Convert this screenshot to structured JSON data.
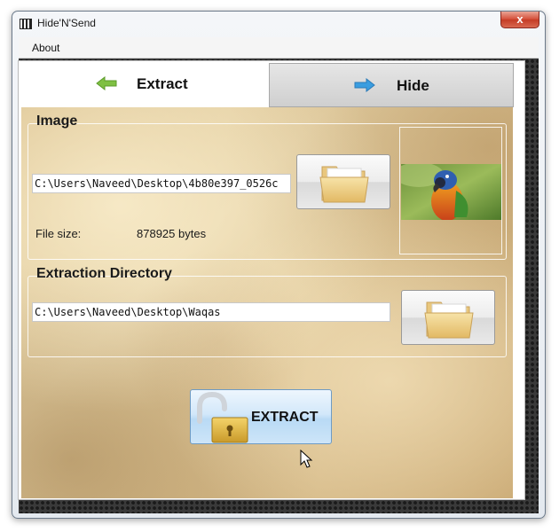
{
  "window": {
    "title": "Hide'N'Send",
    "close_glyph": "x"
  },
  "menu": {
    "items": [
      {
        "label": "About"
      }
    ]
  },
  "tabs": [
    {
      "label": "Extract",
      "icon": "arrow-left-icon",
      "active": true
    },
    {
      "label": "Hide",
      "icon": "arrow-right-icon",
      "active": false
    }
  ],
  "image_group": {
    "title": "Image",
    "path": "C:\\Users\\Naveed\\Desktop\\4b80e397_0526c",
    "file_size_label": "File size:",
    "file_size_value": "878925 bytes",
    "browse_icon": "folder-icon",
    "preview_icon": "parrot-photo"
  },
  "dir_group": {
    "title": "Extraction Directory",
    "path": "C:\\Users\\Naveed\\Desktop\\Waqas",
    "browse_icon": "folder-icon"
  },
  "actions": {
    "extract_label": "EXTRACT",
    "extract_icon": "padlock-open-icon"
  },
  "colors": {
    "accent_green": "#7fc043",
    "accent_blue": "#3a9de0",
    "close_red": "#c43c25"
  }
}
